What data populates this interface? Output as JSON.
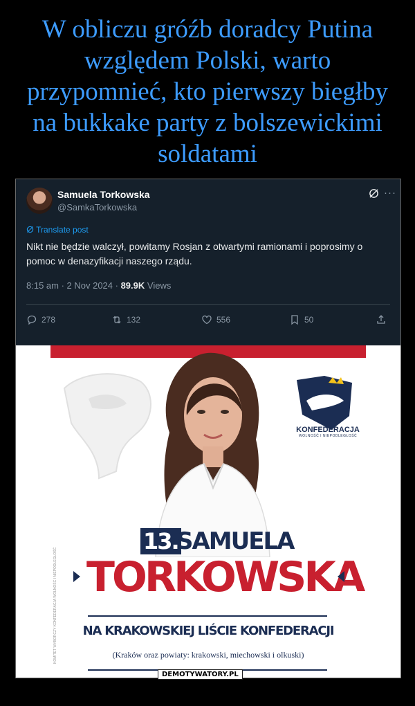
{
  "headline": "W obliczu gróźb doradcy Putina względem Polski, warto przypomnieć, kto pierwszy biegłby na bukkake party z bolszewickimi soldatami",
  "tweet": {
    "author_name": "Samuela Torkowska",
    "author_handle": "@SamkaTorkowska",
    "more_icon": "···",
    "translate_label": "Translate post",
    "text": "Nikt nie będzie walczył, powitamy Rosjan z otwartymi ramionami i poprosimy o pomoc w denazyfikacji naszego rządu.",
    "time": "8:15 am · 2 Nov 2024 · ",
    "views_count": "89.9K",
    "views_label": " Views",
    "replies": "278",
    "reposts": "132",
    "likes": "556",
    "bookmarks": "50",
    "colors": {
      "background": "#15202b",
      "accent": "#1d9bf0"
    }
  },
  "poster": {
    "party_name": "KONFEDERACJA",
    "party_tagline": "WOLNOŚĆ I NIEPODLEGŁOŚĆ",
    "list_number": "13.",
    "first_name": "SAMUELA",
    "surname": "TORKOWSKA",
    "subtitle": "NA KRAKOWSKIEJ LIŚCIE KONFEDERACJI",
    "region": "(Kraków oraz powiaty: krakowski, miechowski i olkuski)",
    "side_text": "KOMITET WYBORCZY KONFEDERACJA WOLNOŚĆ I NIEPODLEGŁOŚĆ",
    "colors": {
      "navy": "#1b2d53",
      "red": "#c8202f"
    }
  },
  "watermark": "DEMOTYWATORY.PL"
}
